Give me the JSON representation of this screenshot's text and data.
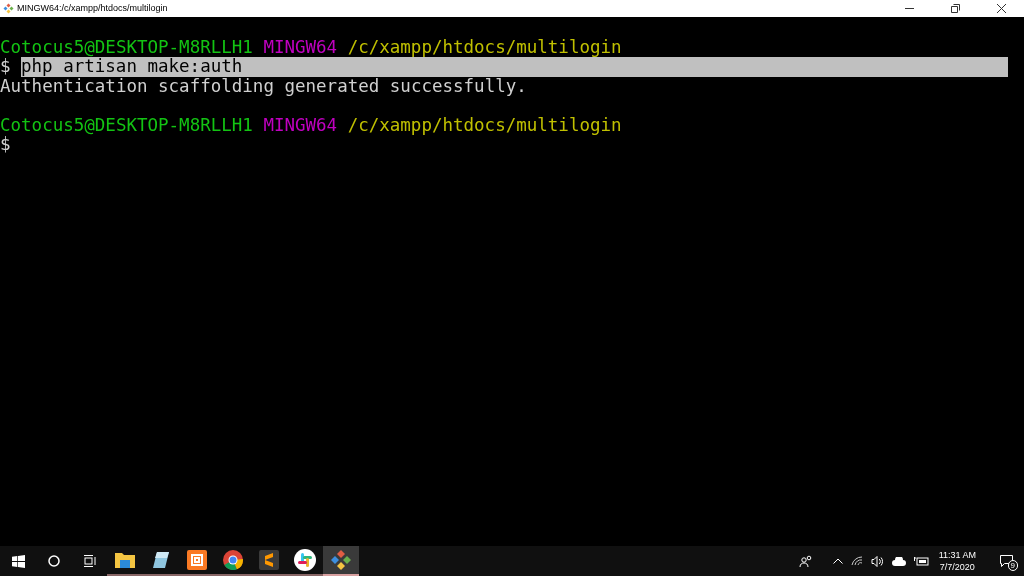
{
  "window": {
    "title": "MINGW64:/c/xampp/htdocs/multilogin"
  },
  "terminal": {
    "lines": [
      {
        "kind": "blank"
      },
      {
        "kind": "prompt",
        "user": "Cotocus5@DESKTOP-M8RLLH1",
        "system": "MINGW64",
        "path": "/c/xampp/htdocs/multilogin"
      },
      {
        "kind": "command",
        "symbol": "$",
        "text": "php artisan make:auth",
        "selected": true
      },
      {
        "kind": "output",
        "text": "Authentication scaffolding generated successfully."
      },
      {
        "kind": "blank"
      },
      {
        "kind": "prompt",
        "user": "Cotocus5@DESKTOP-M8RLLH1",
        "system": "MINGW64",
        "path": "/c/xampp/htdocs/multilogin"
      },
      {
        "kind": "command",
        "symbol": "$"
      }
    ]
  },
  "taskbar": {
    "apps": [
      {
        "kind": "explorer",
        "selected": false
      },
      {
        "kind": "notes",
        "selected": false
      },
      {
        "kind": "xampp",
        "selected": false
      },
      {
        "kind": "chrome",
        "selected": false
      },
      {
        "kind": "sublime",
        "selected": false
      },
      {
        "kind": "slack",
        "selected": false
      },
      {
        "kind": "git",
        "selected": true
      }
    ],
    "time": "11:31 AM",
    "date": "7/7/2020",
    "notification_count": "9"
  }
}
